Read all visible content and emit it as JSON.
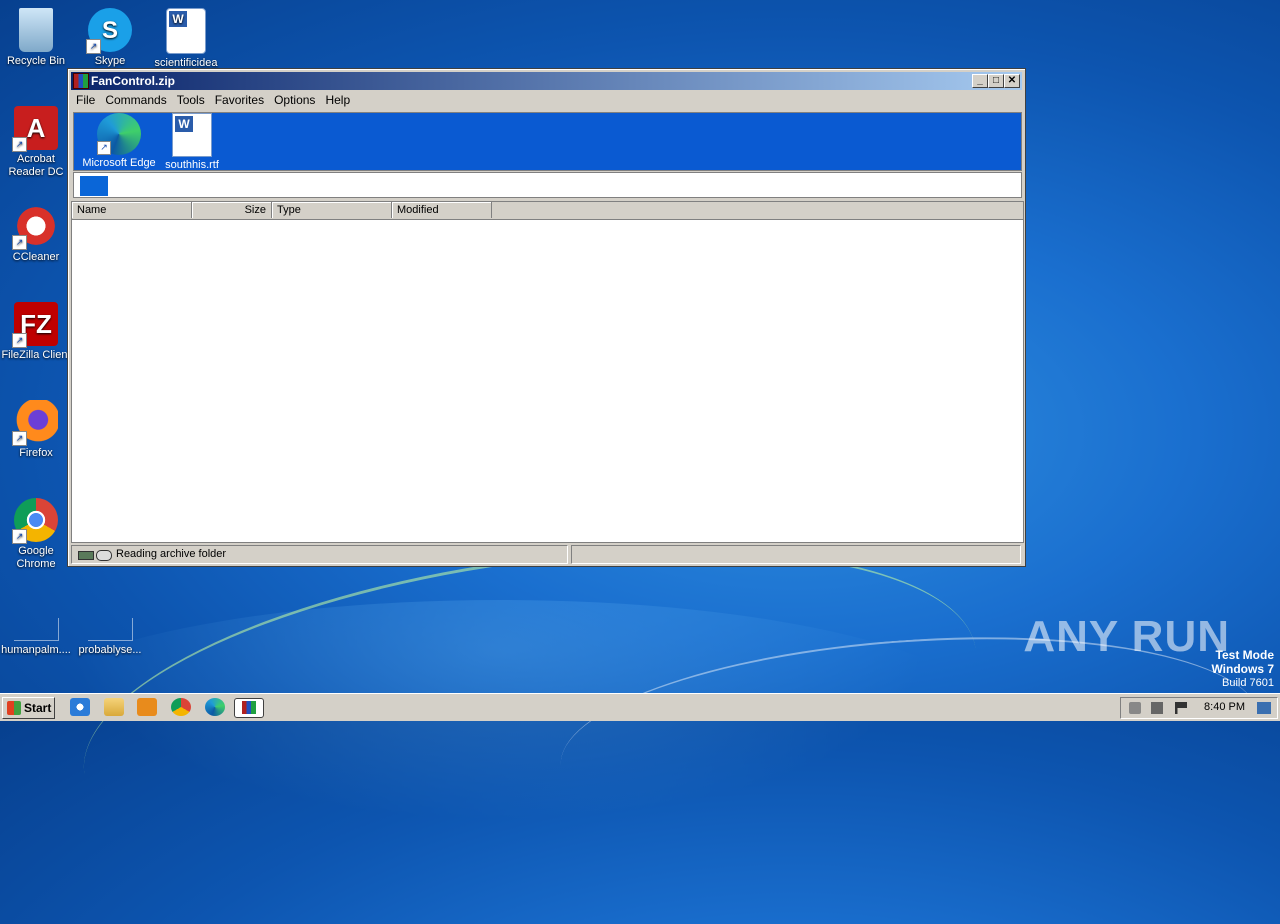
{
  "desktop": {
    "icons": [
      {
        "label": "Recycle Bin",
        "icon": "recycle-bin-icon"
      },
      {
        "label": "Skype",
        "icon": "skype-icon"
      },
      {
        "label": "scientificidea",
        "icon": "word-document-icon"
      },
      {
        "label": "Acrobat Reader DC",
        "icon": "acrobat-icon"
      },
      {
        "label": "CCleaner",
        "icon": "ccleaner-icon"
      },
      {
        "label": "FileZilla Client",
        "icon": "filezilla-icon"
      },
      {
        "label": "Firefox",
        "icon": "firefox-icon"
      },
      {
        "label": "Google Chrome",
        "icon": "chrome-icon"
      },
      {
        "label": "humanpalm....",
        "icon": "blank-file-icon"
      },
      {
        "label": "probablyse...",
        "icon": "blank-file-icon"
      }
    ]
  },
  "window": {
    "title": "FanControl.zip",
    "menu": [
      "File",
      "Commands",
      "Tools",
      "Favorites",
      "Options",
      "Help"
    ],
    "toolbar_items": [
      {
        "label": "Microsoft Edge",
        "icon": "edge-icon"
      },
      {
        "label": "southhis.rtf",
        "icon": "word-document-icon"
      }
    ],
    "columns": [
      "Name",
      "Size",
      "Type",
      "Modified"
    ],
    "status_text": "Reading archive folder"
  },
  "watermark": {
    "brand": "ANY RUN",
    "test_mode": "Test Mode",
    "os": "Windows 7",
    "build": "Build 7601"
  },
  "taskbar": {
    "start_label": "Start",
    "clock": "8:40 PM"
  },
  "colors": {
    "titlebar_start": "#0a246a",
    "titlebar_end": "#a6caf0",
    "toolbar_bg": "#0a5ad2",
    "window_face": "#d4d0c8"
  }
}
